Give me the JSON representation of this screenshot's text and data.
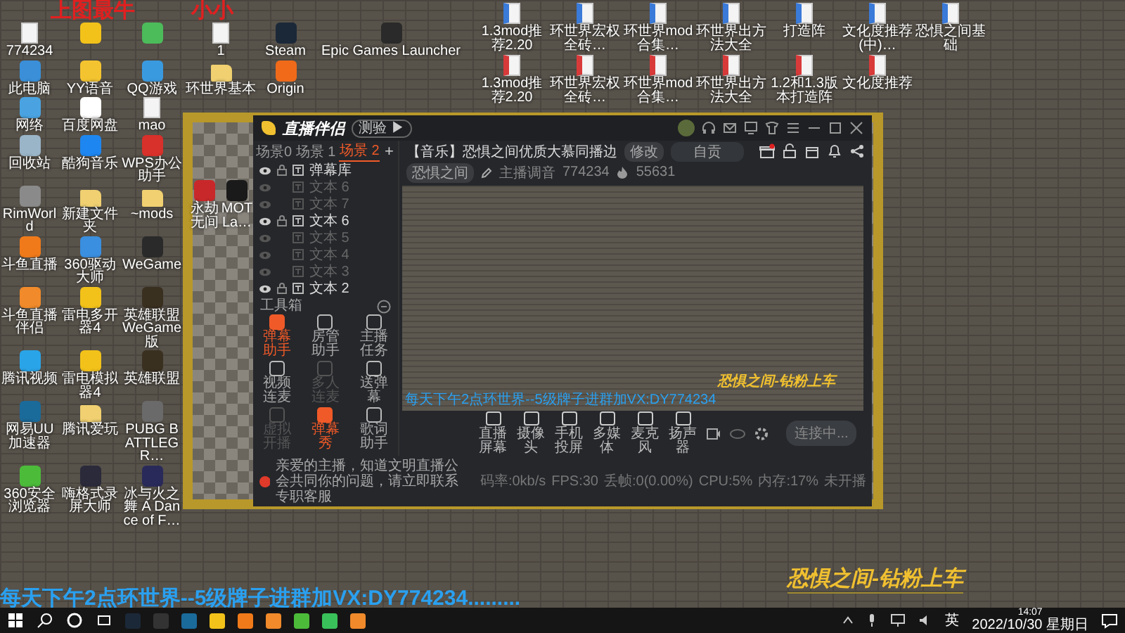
{
  "overlay_text": [
    "上图最牛",
    "小小"
  ],
  "desktop_columns": [
    [
      {
        "label": "774234",
        "kind": "file"
      },
      {
        "label": "此电脑",
        "kind": "app",
        "color": "#3a8fd8"
      },
      {
        "label": "网络",
        "kind": "app",
        "color": "#4aa3e0"
      },
      {
        "label": "回收站",
        "kind": "app",
        "color": "#9ab4c8"
      },
      {
        "label": "RimWorld",
        "kind": "app",
        "color": "#8a8a8a"
      },
      {
        "label": "斗鱼直播",
        "kind": "app",
        "color": "#f07a1a"
      },
      {
        "label": "斗鱼直播伴侣",
        "kind": "app",
        "color": "#f08a2a"
      },
      {
        "label": "腾讯视频",
        "kind": "app",
        "color": "#2aa4e8"
      },
      {
        "label": "网易UU加速器",
        "kind": "app",
        "color": "#1a6a9a"
      },
      {
        "label": "360安全浏览器",
        "kind": "app",
        "color": "#4cbb3a"
      }
    ],
    [
      {
        "kind": "app",
        "color": "#f2c21a"
      },
      {
        "label": "YY语音",
        "kind": "app",
        "color": "#f4c430"
      },
      {
        "label": "百度网盘",
        "kind": "app",
        "color": "#ffffff"
      },
      {
        "label": "酷狗音乐",
        "kind": "app",
        "color": "#1e86f0"
      },
      {
        "label": "新建文件夹",
        "kind": "folder"
      },
      {
        "label": "360驱动大师",
        "kind": "app",
        "color": "#3a8fe0"
      },
      {
        "label": "雷电多开器4",
        "kind": "app",
        "color": "#f2c21a"
      },
      {
        "label": "雷电模拟器4",
        "kind": "app",
        "color": "#f2c21a"
      },
      {
        "label": "腾讯爱玩",
        "kind": "folder"
      },
      {
        "label": "嗨格式录屏大师",
        "kind": "app",
        "color": "#2a2a3a"
      }
    ],
    [
      {
        "kind": "app",
        "color": "#4cbb5a"
      },
      {
        "label": "QQ游戏",
        "kind": "app",
        "color": "#3a9ae0"
      },
      {
        "label": "mao",
        "kind": "file"
      },
      {
        "label": "WPS办公助手",
        "kind": "app",
        "color": "#d8302a"
      },
      {
        "label": "~mods",
        "kind": "folder"
      },
      {
        "label": "WeGame",
        "kind": "app",
        "color": "#2a2a2a"
      },
      {
        "label": "英雄联盟WeGame版",
        "kind": "app",
        "color": "#3a3020"
      },
      {
        "label": "英雄联盟",
        "kind": "app",
        "color": "#3a3020"
      },
      {
        "label": "PUBG BATTLEGR…",
        "kind": "app",
        "color": "#6a6a6a"
      },
      {
        "label": "冰与火之舞 A Dance of F…",
        "kind": "app",
        "color": "#2a2a5a"
      }
    ],
    [
      {
        "label": "1",
        "kind": "file"
      },
      {
        "label": "环世界基本",
        "kind": "folder"
      }
    ],
    [
      {
        "label": "Steam",
        "kind": "app",
        "color": "#1b2838"
      },
      {
        "label": "Origin",
        "kind": "app",
        "color": "#f06a1a"
      }
    ],
    [
      {
        "label": "Epic Games Launcher",
        "kind": "app",
        "color": "#2a2a2a"
      }
    ]
  ],
  "game_shortcuts": [
    {
      "label": "永劫无间",
      "color": "#c8282a"
    },
    {
      "label": "MOTLa…",
      "color": "#1a1a1a"
    }
  ],
  "documents": [
    [
      {
        "label": "1.3mod推荐2.20",
        "kind": "doc"
      },
      {
        "label": "环世界宏权全砖…",
        "kind": "doc"
      },
      {
        "label": "环世界mod合集…",
        "kind": "doc"
      },
      {
        "label": "环世界出方法大全",
        "kind": "doc"
      },
      {
        "label": "打造阵",
        "kind": "doc"
      },
      {
        "label": "文化度推荐(中)…",
        "kind": "doc"
      },
      {
        "label": "恐惧之间基础",
        "kind": "doc"
      }
    ],
    [
      {
        "label": "1.3mod推荐2.20",
        "kind": "pdf"
      },
      {
        "label": "环世界宏权全砖…",
        "kind": "pdf"
      },
      {
        "label": "环世界mod合集…",
        "kind": "pdf"
      },
      {
        "label": "环世界出方法大全",
        "kind": "pdf"
      },
      {
        "label": "1.2和1.3版本打造阵",
        "kind": "pdf"
      },
      {
        "label": "文化度推荐",
        "kind": "pdf"
      }
    ]
  ],
  "app": {
    "name": "直播伴侣",
    "mode_button": "测验 ▶",
    "scene_tabs": [
      {
        "label": "场景0",
        "selected": false
      },
      {
        "label": "场景 1",
        "selected": false
      },
      {
        "label": "场景 2",
        "selected": true
      }
    ],
    "add_scene": "+",
    "layers": [
      {
        "label": "弹幕库",
        "visible": true
      },
      {
        "label": "文本 6",
        "visible": false
      },
      {
        "label": "文本 7",
        "visible": false
      },
      {
        "label": "文本 6",
        "visible": true
      },
      {
        "label": "文本 5",
        "visible": false
      },
      {
        "label": "文本 4",
        "visible": false
      },
      {
        "label": "文本 3",
        "visible": false
      },
      {
        "label": "文本 2",
        "visible": true
      }
    ],
    "toolbox_title": "工具箱",
    "tools": [
      {
        "label": "弹幕助手",
        "highlighted": true,
        "disabled": false
      },
      {
        "label": "房管助手",
        "highlighted": false,
        "disabled": false
      },
      {
        "label": "主播任务",
        "highlighted": false,
        "disabled": false
      },
      {
        "label": "视频连麦",
        "highlighted": false,
        "disabled": false
      },
      {
        "label": "多人连麦",
        "highlighted": false,
        "disabled": true
      },
      {
        "label": "送弹幕",
        "highlighted": false,
        "disabled": false
      },
      {
        "label": "虚拟开播",
        "highlighted": false,
        "disabled": true
      },
      {
        "label": "弹幕秀",
        "highlighted": true,
        "disabled": false
      },
      {
        "label": "歌词助手",
        "highlighted": false,
        "disabled": false
      }
    ],
    "room": {
      "title": "【音乐】恐惧之间优质大慕同播边",
      "edit_button": "修改",
      "category": "自贡",
      "name": "恐惧之间",
      "anchor_label": "主播调音",
      "room_id": "774234",
      "popularity": "55631"
    },
    "preview": {
      "caption": "恐惧之间-钻粉上车",
      "marquee": "每天下午2点环世界--5级牌子进群加VX:DY774234"
    },
    "controls": [
      "直播屏幕",
      "摄像头",
      "手机投屏",
      "多媒体",
      "麦克风",
      "扬声器"
    ],
    "start_button": "连接中...",
    "notice": "亲爱的主播，知道文明直播公会共同你的问题，请立即联系专职客服",
    "status": [
      "码率:0kb/s",
      "FPS:30",
      "丢帧:0(0.00%)",
      "CPU:5%",
      "内存:17%",
      "未开播"
    ]
  },
  "desktop_marquee": "每天下午2点环世界--5级牌子进群加VX:DY774234.........",
  "desktop_caption": "恐惧之间-钻粉上车",
  "taskbar": {
    "input_method": "英",
    "time": "14:07",
    "date": "2022/10/30 星期日"
  }
}
